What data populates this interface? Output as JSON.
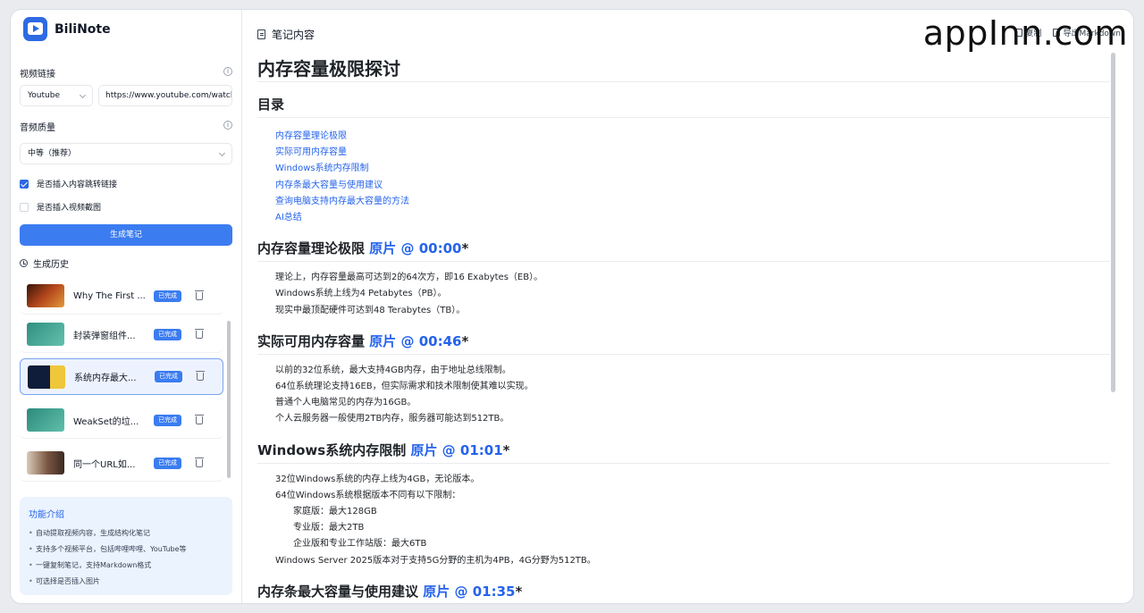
{
  "brand": {
    "name": "BiliNote"
  },
  "form": {
    "video_link_label": "视频链接",
    "platform": "Youtube",
    "url": "https://www.youtube.com/watch",
    "audio_label": "音频质量",
    "audio_value": "中等（推荐）",
    "checkbox_links": "是否插入内容跳转链接",
    "checkbox_screenshot": "是否插入视频截图",
    "generate_button": "生成笔记"
  },
  "history": {
    "title": "生成历史",
    "items": [
      {
        "title": "Why The First ...",
        "status": "已完成",
        "thumb_color": "#7a2c12"
      },
      {
        "title": "封装弹窗组件...",
        "status": "已完成",
        "thumb_color": "#3f9f8e"
      },
      {
        "title": "系统内存最大...",
        "status": "已完成",
        "thumb_color": "#1c2b4a"
      },
      {
        "title": "WeakSet的垃...",
        "status": "已完成",
        "thumb_color": "#3a9d8d"
      },
      {
        "title": "同一个URL如...",
        "status": "已完成",
        "thumb_color": "#6b4a3a"
      }
    ]
  },
  "features": {
    "title": "功能介绍",
    "items": [
      "自动提取视频内容，生成结构化笔记",
      "支持多个视频平台，包括哔哩哔哩、YouTube等",
      "一键复制笔记，支持Markdown格式",
      "可选择是否插入图片"
    ]
  },
  "main": {
    "header": "笔记内容",
    "copy_label": "复制",
    "export_label": "导出Markdown",
    "watermark": "appInn.com",
    "title": "内存容量极限探讨",
    "toc_title": "目录",
    "toc": [
      "内存容量理论极限",
      "实际可用内存容量",
      "Windows系统内存限制",
      "内存条最大容量与使用建议",
      "查询电脑支持内存最大容量的方法",
      "AI总结"
    ],
    "sections": [
      {
        "heading": "内存容量理论极限",
        "timestamp": "原片 @ 00:00",
        "star": "*",
        "lines": [
          {
            "text": "理论上，内存容量最高可达到2的64次方，即16 Exabytes（EB）。",
            "sub": false
          },
          {
            "text": "Windows系统上线为4 Petabytes（PB）。",
            "sub": false
          },
          {
            "text": "现实中最顶配硬件可达到48 Terabytes（TB）。",
            "sub": false
          }
        ]
      },
      {
        "heading": "实际可用内存容量",
        "timestamp": "原片 @ 00:46",
        "star": "*",
        "lines": [
          {
            "text": "以前的32位系统，最大支持4GB内存，由于地址总线限制。",
            "sub": false
          },
          {
            "text": "64位系统理论支持16EB，但实际需求和技术限制使其难以实现。",
            "sub": false
          },
          {
            "text": "普通个人电脑常见的内存为16GB。",
            "sub": false
          },
          {
            "text": "个人云服务器一般使用2TB内存，服务器可能达到512TB。",
            "sub": false
          }
        ]
      },
      {
        "heading": "Windows系统内存限制",
        "timestamp": "原片 @ 01:01",
        "star": "*",
        "lines": [
          {
            "text": "32位Windows系统的内存上线为4GB，无论版本。",
            "sub": false
          },
          {
            "text": "64位Windows系统根据版本不同有以下限制：",
            "sub": false
          },
          {
            "text": "家庭版：最大128GB",
            "sub": true
          },
          {
            "text": "专业版：最大2TB",
            "sub": true
          },
          {
            "text": "企业版和专业工作站版：最大6TB",
            "sub": true
          },
          {
            "text": "Windows Server 2025版本对于支持5G分野的主机为4PB，4G分野为512TB。",
            "sub": false
          }
        ]
      },
      {
        "heading": "内存条最大容量与使用建议",
        "timestamp": "原片 @ 01:35",
        "star": "*",
        "lines": []
      }
    ]
  }
}
